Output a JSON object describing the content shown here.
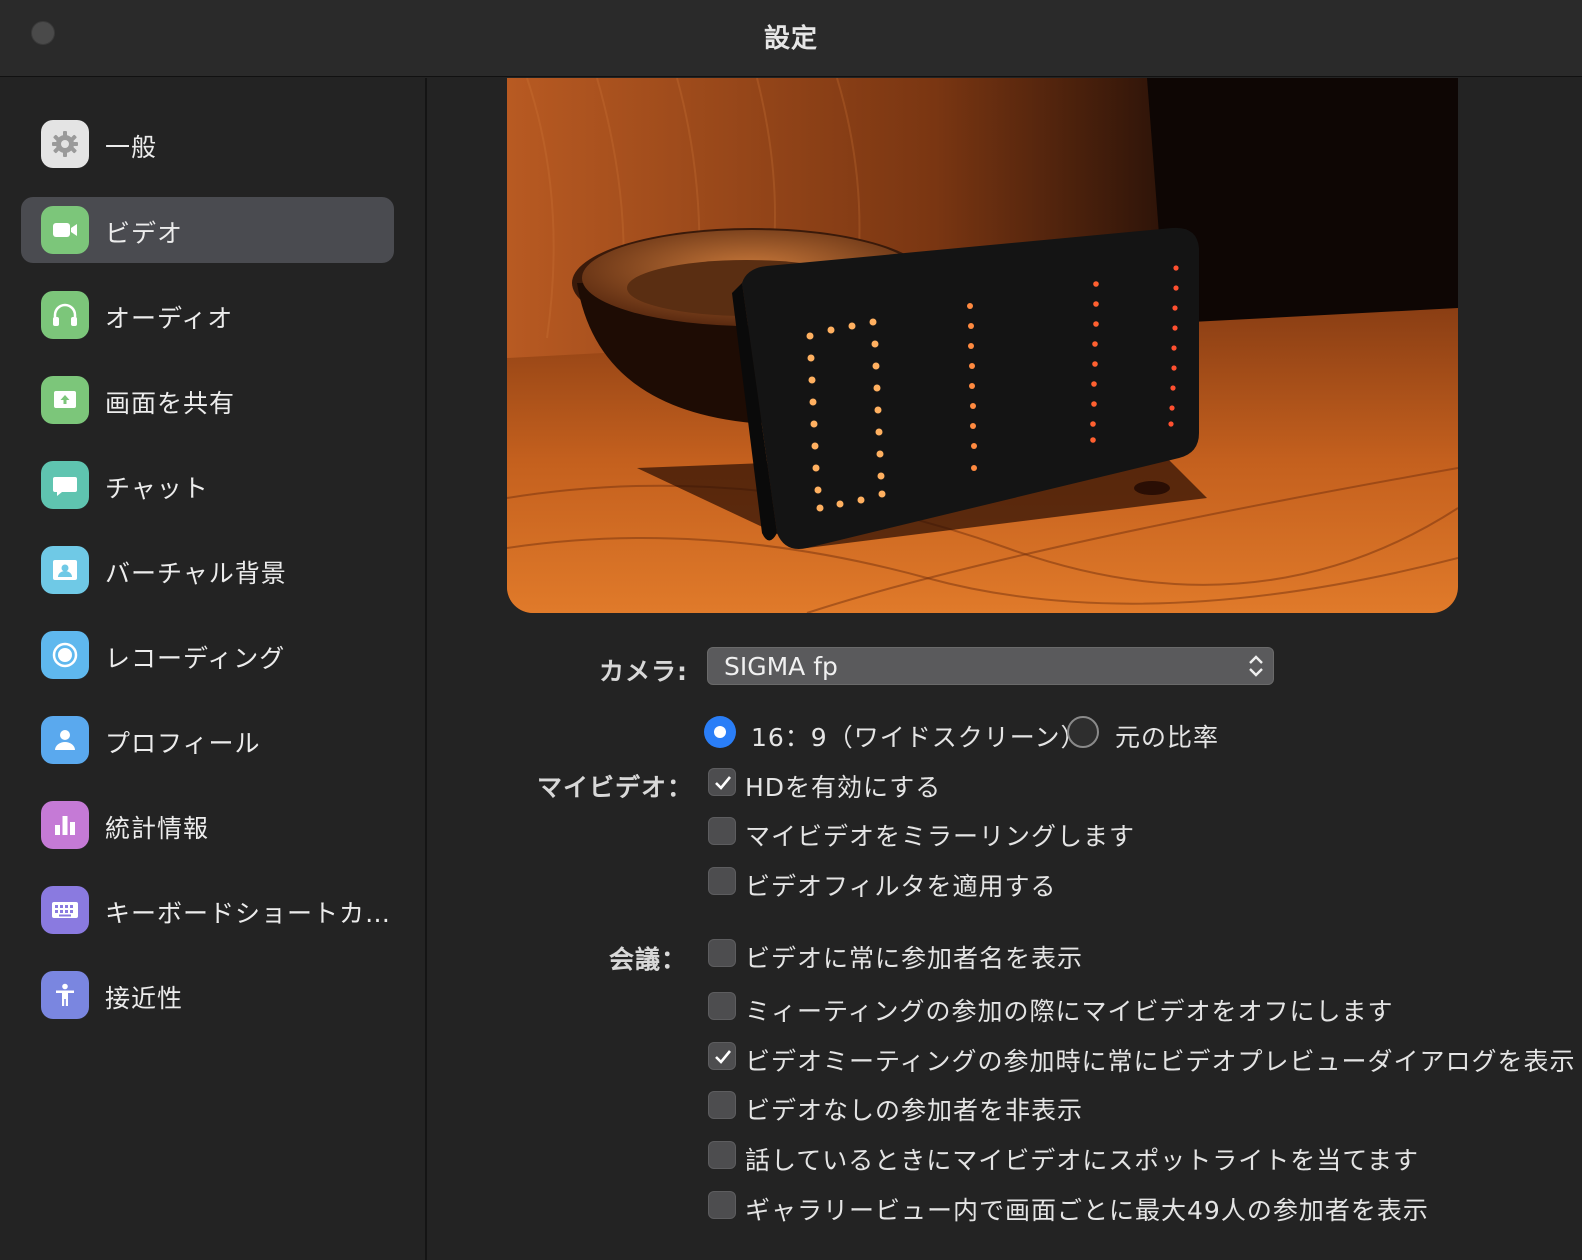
{
  "window": {
    "title": "設定"
  },
  "sidebar": {
    "items": [
      {
        "label": "一般",
        "icon": "gear-icon",
        "color": "#e6e6e6",
        "active": false
      },
      {
        "label": "ビデオ",
        "icon": "video-camera-icon",
        "color": "#7cc67a",
        "active": true
      },
      {
        "label": "オーディオ",
        "icon": "headphones-icon",
        "color": "#7cc67a",
        "active": false
      },
      {
        "label": "画面を共有",
        "icon": "share-screen-icon",
        "color": "#7cc67a",
        "active": false
      },
      {
        "label": "チャット",
        "icon": "chat-bubble-icon",
        "color": "#5fc4b0",
        "active": false
      },
      {
        "label": "バーチャル背景",
        "icon": "virtual-background-icon",
        "color": "#6fc9e6",
        "active": false
      },
      {
        "label": "レコーディング",
        "icon": "record-icon",
        "color": "#5fb8ee",
        "active": false
      },
      {
        "label": "プロフィール",
        "icon": "profile-icon",
        "color": "#5aa9ee",
        "active": false
      },
      {
        "label": "統計情報",
        "icon": "bar-chart-icon",
        "color": "#c57ad6",
        "active": false
      },
      {
        "label": "キーボードショートカ…",
        "icon": "keyboard-icon",
        "color": "#8a7ae0",
        "active": false
      },
      {
        "label": "接近性",
        "icon": "accessibility-icon",
        "color": "#7a86e0",
        "active": false
      }
    ]
  },
  "camera": {
    "label": "カメラ:",
    "selected": "SIGMA fp"
  },
  "aspect": {
    "option_wide": "16：9（ワイドスクリーン）",
    "option_original": "元の比率",
    "selected": "wide"
  },
  "my_video": {
    "label": "マイビデオ：",
    "options": [
      {
        "label": "HDを有効にする",
        "checked": true
      },
      {
        "label": "マイビデオをミラーリングします",
        "checked": false
      },
      {
        "label": "ビデオフィルタを適用する",
        "checked": false
      }
    ]
  },
  "meeting": {
    "label": "会議：",
    "options": [
      {
        "label": "ビデオに常に参加者名を表示",
        "checked": false
      },
      {
        "label": "ミィーティングの参加の際にマイビデオをオフにします",
        "checked": false
      },
      {
        "label": "ビデオミーティングの参加時に常にビデオプレビューダイアログを表示",
        "checked": true
      },
      {
        "label": "ビデオなしの参加者を非表示",
        "checked": false
      },
      {
        "label": "話しているときにマイビデオにスポットライトを当てます",
        "checked": false
      },
      {
        "label": "ギャラリービュー内で画面ごとに最大49人の参加者を表示",
        "checked": false
      }
    ]
  },
  "preview": {
    "clock_display": "0111"
  }
}
